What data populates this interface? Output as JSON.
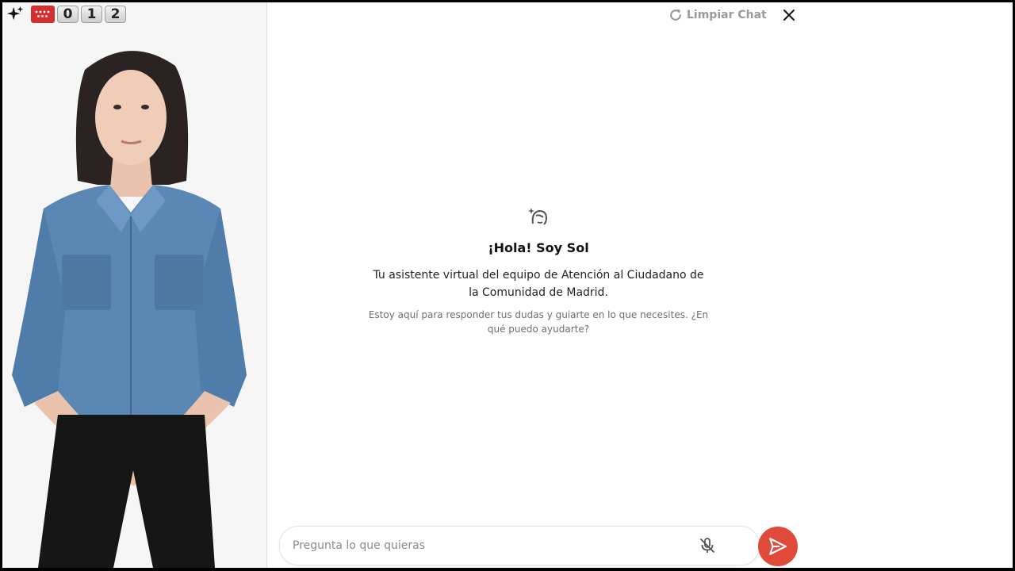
{
  "brand": {
    "digits": [
      "0",
      "1",
      "2"
    ],
    "icons": {
      "sparkle": "sparkle-icon",
      "flag": "madrid-flag-icon"
    },
    "flag_color": "#d32f2f"
  },
  "header": {
    "clear_chat_label": "Limpiar Chat",
    "icons": {
      "refresh": "refresh-icon",
      "close": "close-icon"
    }
  },
  "welcome": {
    "title": "¡Hola! Soy Sol",
    "subtitle": "Tu asistente virtual del equipo de Atención al Ciudadano de la Comunidad de Madrid.",
    "note": "Estoy aquí para responder tus dudas y guiarte en lo que necesites. ¿En qué puedo ayudarte?",
    "icon": "assistant-icon"
  },
  "composer": {
    "placeholder": "Pregunta lo que quieras",
    "value": "",
    "icons": {
      "mic": "mic-off-icon",
      "send": "send-icon"
    },
    "send_color": "#e04a3a"
  }
}
